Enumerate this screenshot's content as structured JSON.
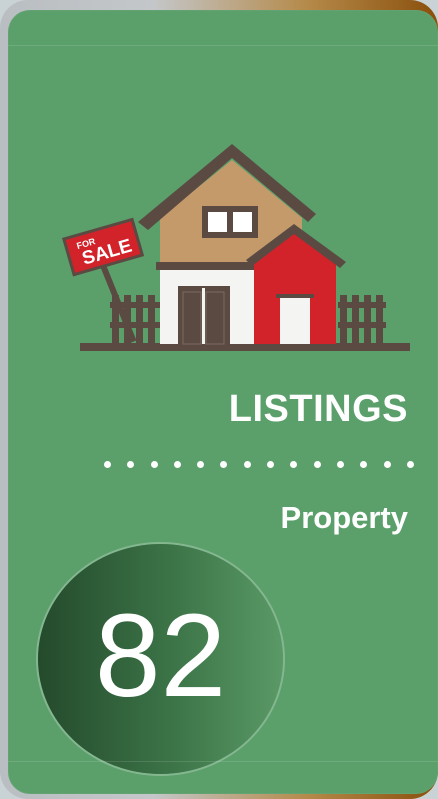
{
  "card": {
    "title": "LISTINGS",
    "subtitle": "Property",
    "count": "82",
    "sign_text_small": "FOR",
    "sign_text_large": "SALE"
  },
  "icons": {
    "illustration": "house-for-sale-icon"
  },
  "colors": {
    "card_background": "#5b9f6b",
    "badge_dark": "#244a2c",
    "text": "#ffffff",
    "sign_red": "#d2232a",
    "roof_brown": "#5a4a42"
  }
}
